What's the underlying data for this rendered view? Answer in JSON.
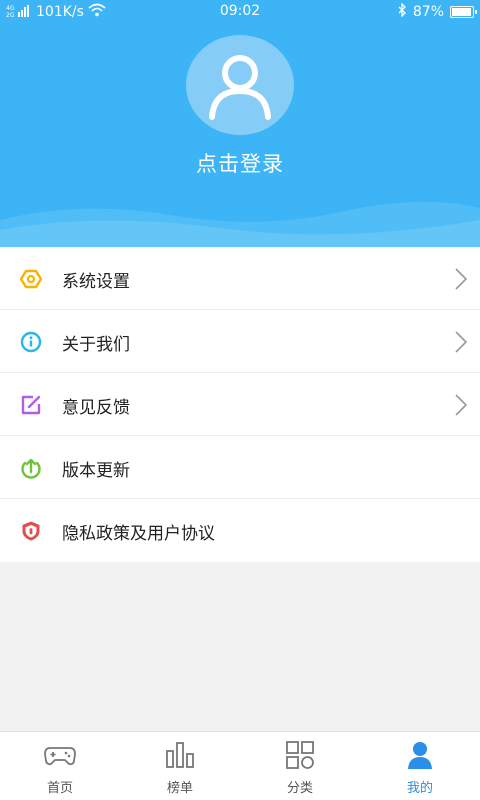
{
  "status_bar": {
    "network_speed": "101K/s",
    "time": "09:02",
    "battery_percent": "87%",
    "battery_level": 0.87
  },
  "profile": {
    "login_label": "点击登录",
    "avatar_icon": "user-avatar-icon"
  },
  "menu": {
    "items": [
      {
        "label": "系统设置",
        "icon": "settings-hexagon-icon",
        "color": "#f5b400",
        "has_arrow": true
      },
      {
        "label": "关于我们",
        "icon": "info-icon",
        "color": "#29b6e8",
        "has_arrow": true
      },
      {
        "label": "意见反馈",
        "icon": "feedback-edit-icon",
        "color": "#b25fe3",
        "has_arrow": true
      },
      {
        "label": "版本更新",
        "icon": "update-upload-icon",
        "color": "#6fc33a",
        "has_arrow": false
      },
      {
        "label": "隐私政策及用户协议",
        "icon": "privacy-shield-icon",
        "color": "#e24d4d",
        "has_arrow": false
      }
    ]
  },
  "bottom_nav": {
    "items": [
      {
        "label": "首页",
        "icon": "gamepad-icon",
        "active": false
      },
      {
        "label": "榜单",
        "icon": "bar-chart-icon",
        "active": false
      },
      {
        "label": "分类",
        "icon": "grid-icon",
        "active": false
      },
      {
        "label": "我的",
        "icon": "person-icon",
        "active": true
      }
    ]
  },
  "colors": {
    "header_bg": "#3cb4f5",
    "active_tab": "#2a8fe6"
  }
}
